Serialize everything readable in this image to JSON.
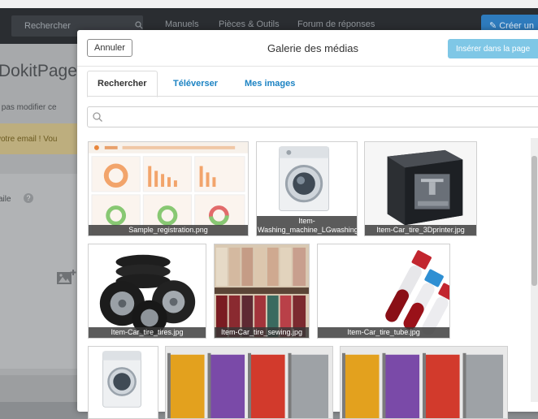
{
  "background": {
    "search_placeholder": "Rechercher",
    "nav_links": [
      "Manuels",
      "Pièces & Outils",
      "Forum de réponses"
    ],
    "create_button": "Créer un",
    "page_title": "DokitPage",
    "subtitle": "z pas modifier ce",
    "alert_text": "votre email ! Vou",
    "section_label": "aile",
    "help_icon": "?"
  },
  "modal": {
    "cancel_label": "Annuler",
    "title": "Galerie des médias",
    "insert_label": "Insérer dans la page",
    "tabs": [
      {
        "label": "Rechercher",
        "active": true
      },
      {
        "label": "Téléverser",
        "active": false
      },
      {
        "label": "Mes images",
        "active": false
      }
    ],
    "search": {
      "value": "",
      "placeholder": ""
    },
    "images": [
      {
        "caption": "Sample_registration.png",
        "art": "registration"
      },
      {
        "caption": "Item-Washing_machine_LGwashingmachine.jpg",
        "art": "washer"
      },
      {
        "caption": "Item-Car_tire_3Dprinter.jpg",
        "art": "printer"
      },
      {
        "caption": "Item-Car_tire_tires.jpg",
        "art": "tires"
      },
      {
        "caption": "Item-Car_tire_sewing.jpg",
        "art": "sewing"
      },
      {
        "caption": "Item-Car_tire_tube.jpg",
        "art": "tube"
      },
      {
        "caption": "",
        "art": "washer"
      },
      {
        "caption": "",
        "art": "filament"
      },
      {
        "caption": "",
        "art": "filament"
      }
    ]
  },
  "colors": {
    "accent": "#1c83c3",
    "insert_button": "#7fc7e6",
    "nav_background": "#2a2d31"
  }
}
